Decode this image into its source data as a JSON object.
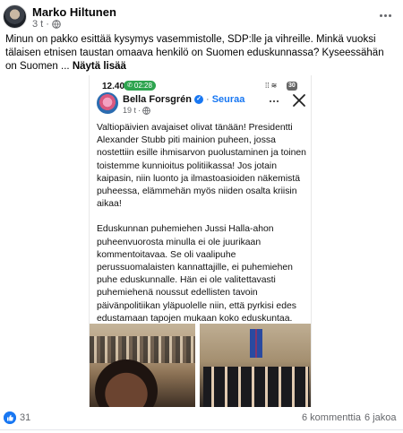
{
  "post": {
    "author": "Marko Hiltunen",
    "time": "3 t",
    "text": "Minun on pakko esittää kysymys vasemmistolle, SDP:lle ja vihreille. Minkä vuoksi tälaisen etnisen taustan omaava henkilö on Suomen eduskunnassa? Kyseessähän on Suomen ...",
    "see_more": "Näytä lisää"
  },
  "screenshot": {
    "status_bar": {
      "time": "12.40",
      "call": "02:28",
      "battery": "30"
    },
    "author": "Bella Forsgrén",
    "follow": "Seuraa",
    "time": "19 t",
    "paragraphs": [
      "Valtiopäivien avajaiset olivat tänään! Presidentti Alexander Stubb piti mainion puheen, jossa nostettiin esille ihmisarvon puolustaminen ja toinen toistemme kunnioitus politiikassa! Jos jotain kaipasin, niin luonto ja ilmastoasioiden näkemistä puheessa, elämmehän myös niiden osalta kriisin aikaa!",
      "Eduskunnan puhemiehen Jussi Halla-ahon puheenvuorosta minulla ei ole juurikaan kommentoitavaa. Se oli vaalipuhe perussuomalaisten kannattajille, ei puhemiehen puhe eduskunnalle. Hän ei ole valitettavasti puhemiehenä noussut edellisten tavoin päivänpolitiikan yläpuolelle niin, että pyrkisi edes edustamaan tapojen mukaan koko eduskuntaa. Surullista!"
    ]
  },
  "footer": {
    "reactions": "31",
    "comments": "6 kommenttia",
    "shares": "6 jakoa"
  },
  "icons": {
    "globe": "globe-icon",
    "more": "more-options-icon",
    "close": "close-icon",
    "verified": "verified-badge-icon",
    "like": "like-icon"
  },
  "colors": {
    "accent": "#1877f2",
    "call": "#2ea44f",
    "muted": "#65676b"
  }
}
